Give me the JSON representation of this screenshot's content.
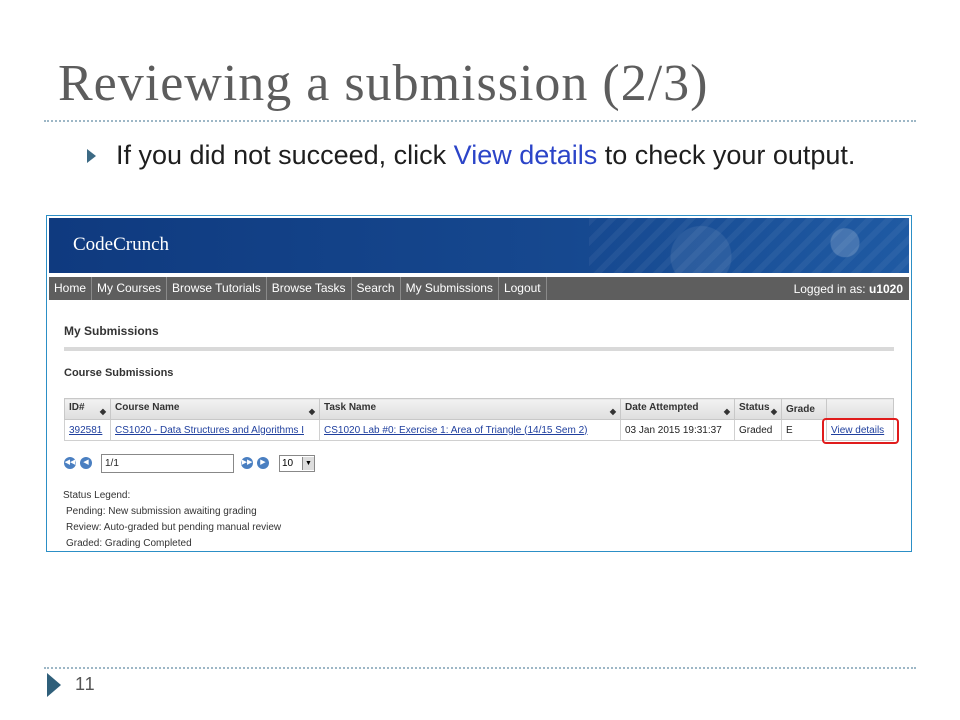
{
  "slide": {
    "title": "Reviewing a submission (2/3)",
    "bullet_before": "If you did not succeed, click ",
    "bullet_link": "View details",
    "bullet_after": " to check your output.",
    "page_number": "11"
  },
  "app": {
    "brand": "CodeCrunch",
    "nav": [
      "Home",
      "My Courses",
      "Browse Tutorials",
      "Browse Tasks",
      "Search",
      "My Submissions",
      "Logout"
    ],
    "logged_in_label": "Logged in as: ",
    "logged_in_user": "u1020",
    "page_title": "My Submissions",
    "section_title": "Course Submissions"
  },
  "table": {
    "columns": [
      "ID#",
      "Course Name",
      "Task Name",
      "Date Attempted",
      "Status",
      "Grade",
      ""
    ],
    "rows": [
      {
        "id": "392581",
        "course": "CS1020 - Data Structures and Algorithms I",
        "task": "CS1020 Lab #0: Exercise 1: Area of Triangle (14/15 Sem 2)",
        "date": "03 Jan 2015 19:31:37",
        "status": "Graded",
        "grade": "E",
        "action": "View details"
      }
    ]
  },
  "pager": {
    "page_value": "1/1",
    "page_size": "10"
  },
  "legend": {
    "heading": "Status Legend:",
    "items": [
      "Pending: New submission awaiting grading",
      "Review:  Auto-graded but pending manual review",
      "Graded:  Grading Completed"
    ]
  },
  "colors": {
    "title_gray": "#5d5d5d",
    "link_blue": "#2b44c8",
    "banner_blue": "#16488f",
    "highlight_red": "#e01c1c"
  }
}
